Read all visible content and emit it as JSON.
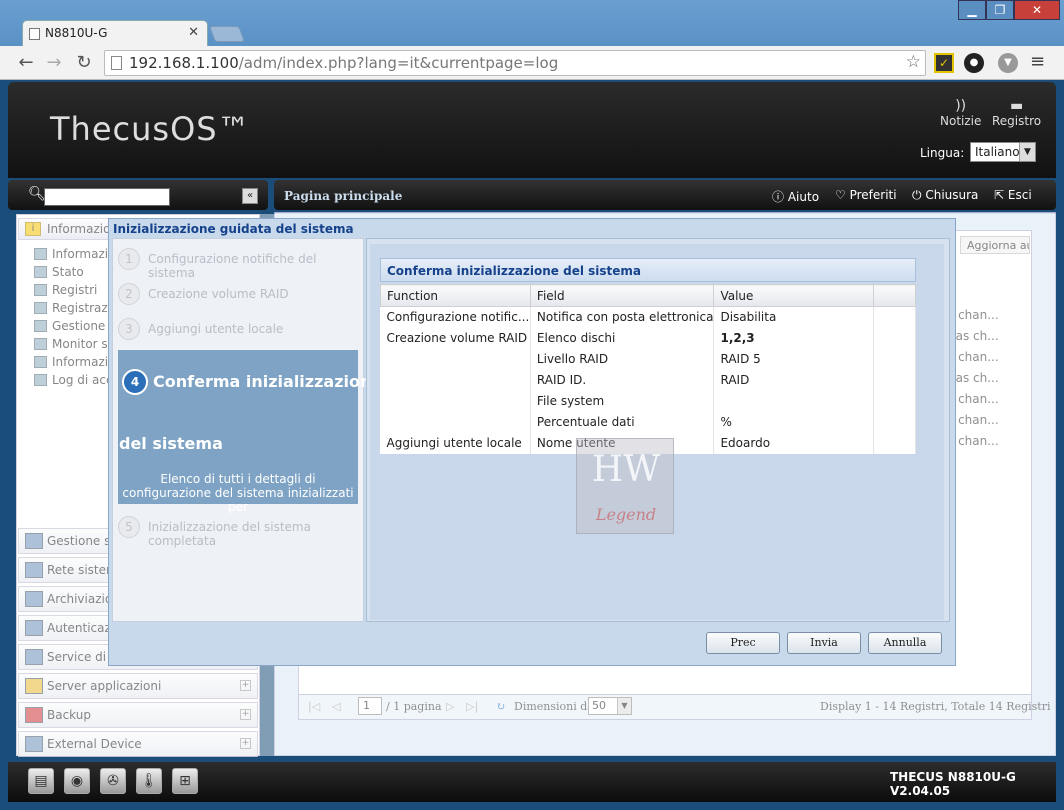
{
  "browser": {
    "tab_title": "N8810U-G",
    "url_host": "192.168.1.100",
    "url_path": "/adm/index.php?lang=it&currentpage=log",
    "win_min": "▁",
    "win_max": "❐",
    "win_close": "✕"
  },
  "header": {
    "brand": "ThecusOS™",
    "news_label": "Notizie",
    "log_label": "Registro",
    "language_label": "Lingua:",
    "language_value": "Italiano"
  },
  "sidebar": {
    "section_title": "Informazioni di sistema",
    "tree_items": [
      "Informazioni",
      "Stato",
      "Registri",
      "Registrazione",
      "Gestione S",
      "Monitor sis",
      "Informazio",
      "Log di acc"
    ],
    "accordion": [
      "Gestione sistema",
      "Rete sistema",
      "Archiviazione",
      "Autenticazione utente e gruppo",
      "Service di rete",
      "Server applicazioni",
      "Backup",
      "External Device"
    ]
  },
  "main": {
    "title": "Pagina principale",
    "help": "Aiuto",
    "favorites": "Preferiti",
    "shutdown": "Chiusura",
    "logout": "Esci",
    "refresh": "Aggiorna auto",
    "bg_cells": [
      "s chan...",
      "has ch...",
      "s chan...",
      "has ch...",
      "s chan...",
      "s chan...",
      "s chan..."
    ],
    "pager": {
      "page": "1",
      "of_pages": "/ 1 pagina",
      "size_label": "Dimensioni dati",
      "size_value": "50",
      "display": "Display 1 - 14 Registri,  Totale 14 Registri"
    }
  },
  "footer": {
    "version": "THECUS N8810U-G V2.04.05"
  },
  "wizard": {
    "title": "Inizializzazione guidata del sistema",
    "steps": [
      {
        "num": "1",
        "label": "Configurazione notifiche del sistema"
      },
      {
        "num": "2",
        "label": "Creazione volume RAID"
      },
      {
        "num": "3",
        "label": "Aggiungi utente locale"
      },
      {
        "num": "5",
        "label": "Inizializzazione del sistema completata"
      }
    ],
    "current_step": {
      "num": "4",
      "label_line1": "Conferma inizializzazione",
      "label_line2": "del sistema",
      "description": "Elenco di tutti i dettagli di configurazione del sistema inizializzati per"
    },
    "confirm_title": "Conferma inizializzazione del sistema",
    "columns": [
      "Function",
      "Field",
      "Value"
    ],
    "rows": [
      [
        "Configurazione notific...",
        "Notifica con posta elettronica",
        "Disabilita"
      ],
      [
        "Creazione volume RAID",
        "Elenco dischi",
        "1,2,3"
      ],
      [
        "",
        "Livello RAID",
        "RAID 5"
      ],
      [
        "",
        "RAID ID.",
        "RAID"
      ],
      [
        "",
        "File system",
        ""
      ],
      [
        "",
        "Percentuale dati",
        "%"
      ],
      [
        "Aggiungi utente locale",
        "Nome utente",
        "Edoardo"
      ]
    ],
    "buttons": {
      "prev": "Prec",
      "send": "Invia",
      "cancel": "Annulla"
    }
  },
  "watermark": {
    "top": "HW",
    "bottom": "Legend"
  }
}
